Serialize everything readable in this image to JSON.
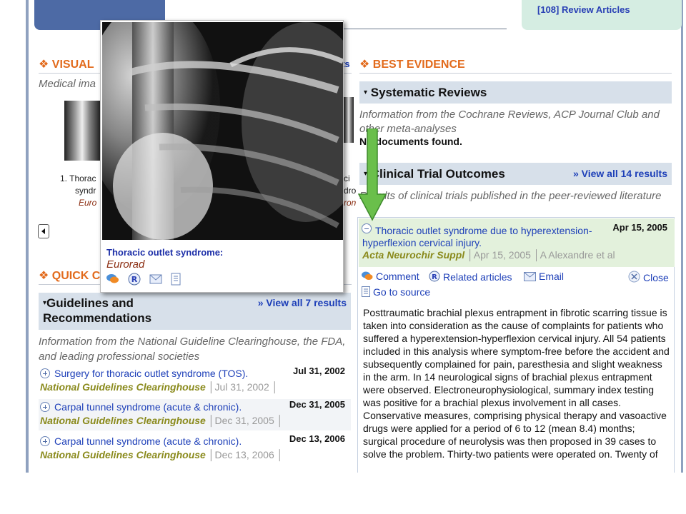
{
  "header": {
    "review_articles_link": "[108] Review Articles"
  },
  "visual": {
    "title": "❖ VISUAL",
    "title_suffix": "ts",
    "description": "Medical ima",
    "items": [
      {
        "caption_line1": "1. Thorac",
        "caption_line2": "syndr",
        "source": "Euro"
      },
      {
        "caption_line1": "ci",
        "caption_line2": "dro",
        "source": "ron"
      }
    ]
  },
  "quick": {
    "title": "❖ QUICK C"
  },
  "guidelines": {
    "header_line1": "Guidelines and",
    "header_line2": "Recommendations",
    "view_all": "» View all 7 results",
    "description": "Information from the National Guideline Clearinghouse, the FDA, and leading professional societies",
    "items": [
      {
        "title": "Surgery for thoracic outlet syndrome (TOS).",
        "date": "Jul 31, 2002",
        "source": "National Guidelines Clearinghouse",
        "meta": "Jul 31, 2002"
      },
      {
        "title": "Carpal tunnel syndrome (acute & chronic).",
        "date": "Dec 31, 2005",
        "source": "National Guidelines Clearinghouse",
        "meta": "Dec 31, 2005"
      },
      {
        "title": "Carpal tunnel syndrome (acute & chronic).",
        "date": "Dec 13, 2006",
        "source": "National Guidelines Clearinghouse",
        "meta": "Dec 13, 2006"
      }
    ]
  },
  "best_evidence": {
    "title": "❖ BEST EVIDENCE",
    "systematic": {
      "header": "Systematic Reviews",
      "description": "Information from the Cochrane Reviews, ACP Journal Club and other meta-analyses",
      "no_docs": "No documents found."
    },
    "clinical": {
      "header": "Clinical Trial Outcomes",
      "view_all": "» View all 14 results",
      "description": "Results of clinical trials published in the peer-reviewed literature"
    }
  },
  "detail": {
    "title": "Thoracic outlet syndrome due to hyperextension-hyperflexion cervical injury.",
    "date": "Apr 15, 2005",
    "journal": "Acta Neurochir Suppl",
    "meta_date": "Apr 15, 2005",
    "authors": "A Alexandre et al",
    "actions": {
      "comment": "Comment",
      "related": "Related articles",
      "email": "Email",
      "close": "Close",
      "source": "Go to source"
    },
    "abstract": "Posttraumatic brachial plexus entrapment in fibrotic scarring tissue is taken into consideration as the cause of complaints for patients who suffered a hyperextension-hyperflexion cervical injury. All 54 patients included in this analysis where symptom-free before the accident and subsequently complained for pain, paresthesia and slight weakness in the arm. In 14 neurological signs of brachial plexus entrapment were observed. Electroneurophysiological, summary index testing was positive for a brachial plexus involvement in all cases. Conservative measures, comprising physical therapy and vasoactive drugs were applied for a period of 6 to 12 (mean 8.4) months; surgical procedure of neurolysis was then proposed in 39 cases to solve the problem. Thirty-two patients were operated on. Twenty of"
  },
  "popup": {
    "title": "Thoracic outlet syndrome:",
    "source": "Eurorad"
  },
  "colors": {
    "section_title": "#e26a1b",
    "link": "#1d3fb8",
    "source_olive": "#8a8a1c",
    "header_band": "#d7e0ea",
    "highlight_green": "#e3f1dc",
    "arrow_green": "#6abf4b"
  }
}
